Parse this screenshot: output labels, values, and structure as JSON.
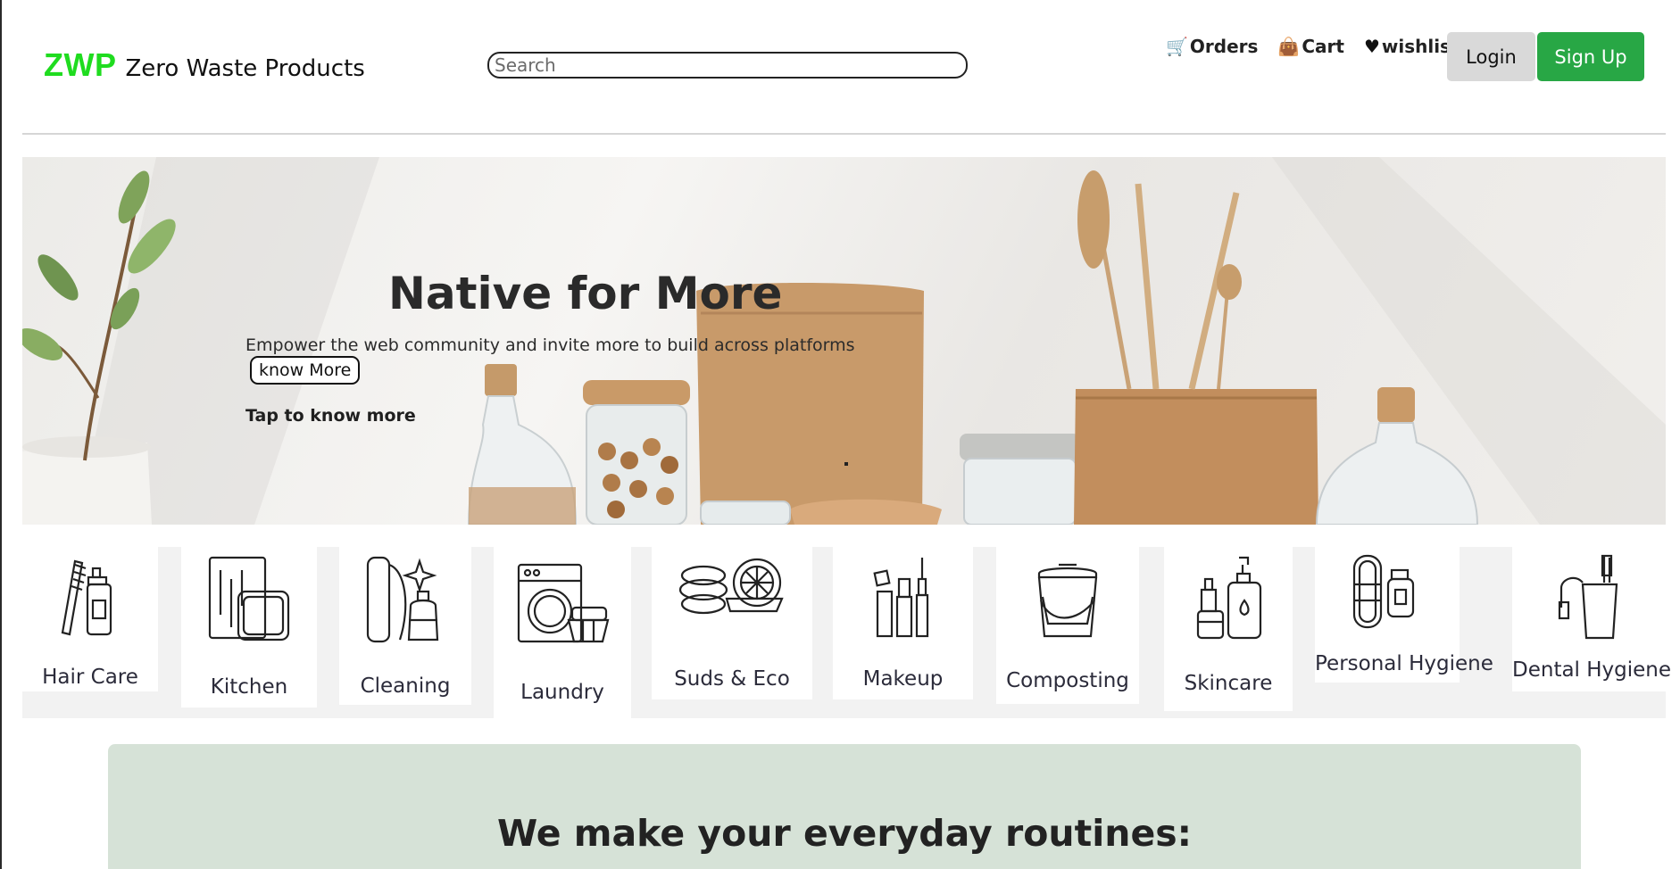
{
  "header": {
    "logo_mark": "ZWP",
    "logo_text": "Zero Waste Products",
    "search_placeholder": "Search",
    "nav": [
      {
        "label": "Orders",
        "icon": "shopping-cart-icon"
      },
      {
        "label": "Cart",
        "icon": "shopping-bag-icon"
      },
      {
        "label": "wishlist",
        "icon": "heart-icon"
      }
    ],
    "login_label": "Login",
    "signup_label": "Sign Up"
  },
  "hero": {
    "title": "Native for More",
    "subtitle": "Empower the web community and invite more to build across platforms",
    "button_label": "know More",
    "link_label": "Tap to know more"
  },
  "categories": [
    {
      "label": "Hair Care",
      "icon": "hair-care-icon"
    },
    {
      "label": "Kitchen",
      "icon": "kitchen-icon"
    },
    {
      "label": "Cleaning",
      "icon": "cleaning-icon"
    },
    {
      "label": "Laundry",
      "icon": "laundry-icon"
    },
    {
      "label": "Suds & Eco",
      "icon": "soap-icon"
    },
    {
      "label": "Makeup",
      "icon": "makeup-icon"
    },
    {
      "label": "Composting",
      "icon": "compost-bin-icon"
    },
    {
      "label": "Skincare",
      "icon": "skincare-icon"
    },
    {
      "label": "Personal Hygiene",
      "icon": "personal-hygiene-icon"
    },
    {
      "label": "Dental Hygiene",
      "icon": "toothbrush-icon"
    }
  ],
  "routine": {
    "title": "We make your everyday routines:"
  },
  "colors": {
    "brand_green": "#1fdc1f",
    "signup_green": "#28a745",
    "login_gray": "#d9d9d9",
    "routine_bg": "#d6e2d7"
  }
}
